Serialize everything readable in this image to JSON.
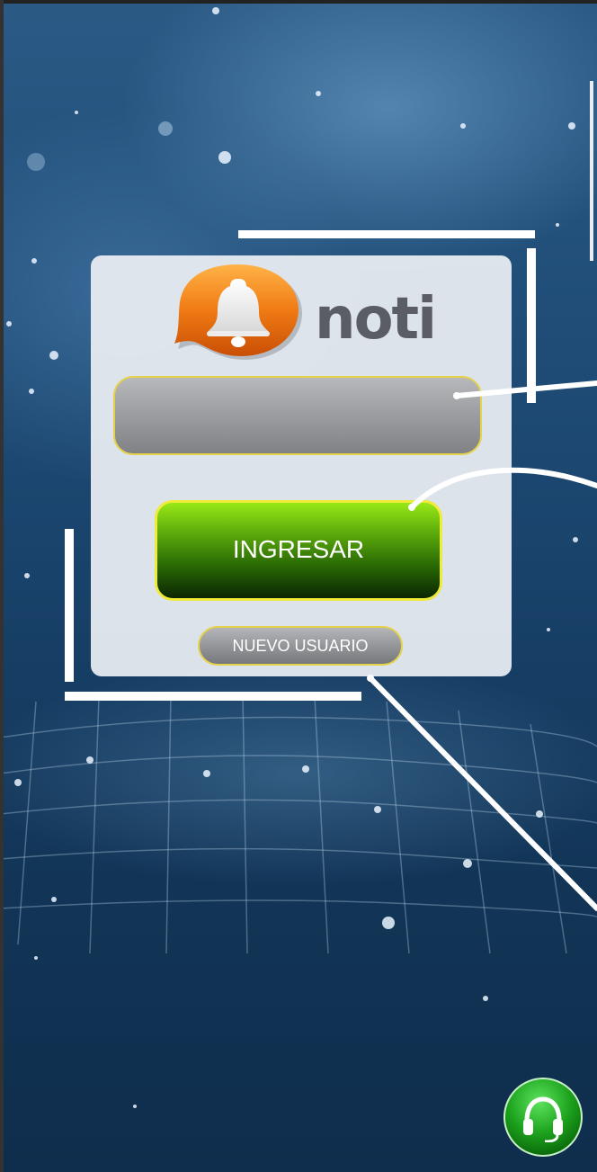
{
  "app": {
    "logo_text": "noti"
  },
  "login": {
    "user_field_value": "",
    "user_field_placeholder": "",
    "login_button_label": "INGRESAR",
    "new_user_button_label": "NUEVO USUARIO"
  },
  "support": {
    "icon": "headset-icon"
  },
  "colors": {
    "login_button": "#5fae0c",
    "logo_orange": "#f07a14",
    "support_button": "#1ea41e"
  }
}
